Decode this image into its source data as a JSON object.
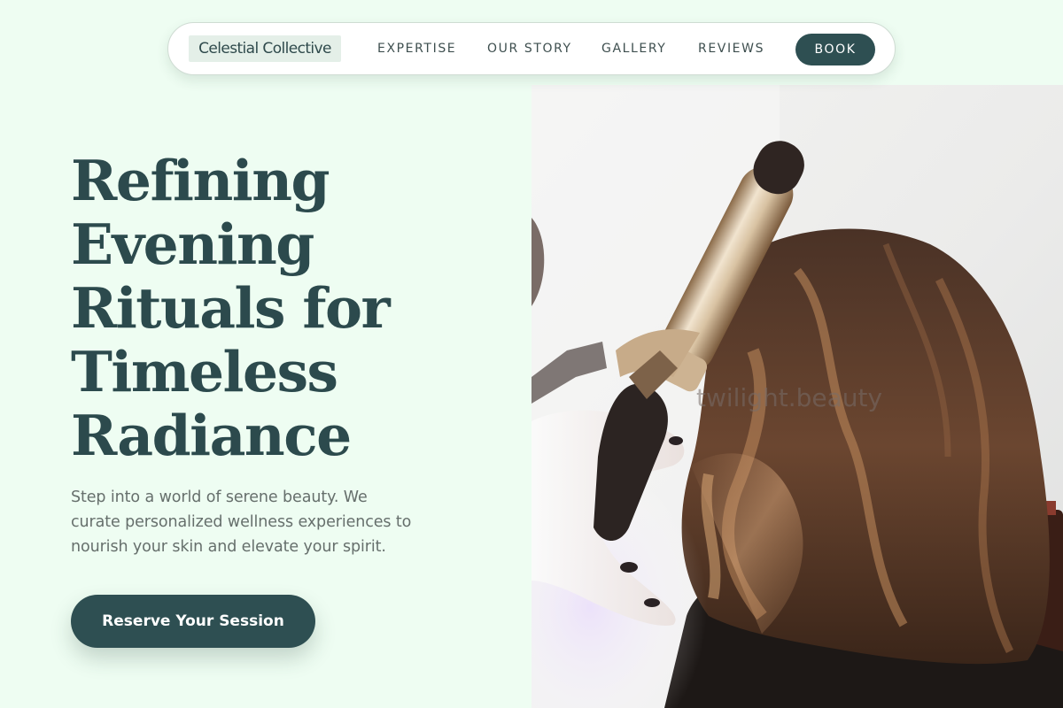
{
  "nav": {
    "brand": "Celestial Collective",
    "links": [
      "EXPERTISE",
      "OUR STORY",
      "GALLERY",
      "REVIEWS"
    ],
    "book_label": "BOOK"
  },
  "hero": {
    "headline_lines": [
      "Refining",
      "Evening",
      "Rituals for",
      "Timeless",
      "Radiance"
    ],
    "lead_lines": [
      "Step into a world of serene beauty. We",
      "curate personalized wellness experiences to",
      "nourish your skin and elevate your spirit."
    ],
    "cta_label": "Reserve Your Session",
    "image_watermark": "twilight.beauty"
  },
  "colors": {
    "background": "#eefdf2",
    "accent": "#2e4f52",
    "heading": "#2c4a4d",
    "body_text": "#666f6c"
  }
}
